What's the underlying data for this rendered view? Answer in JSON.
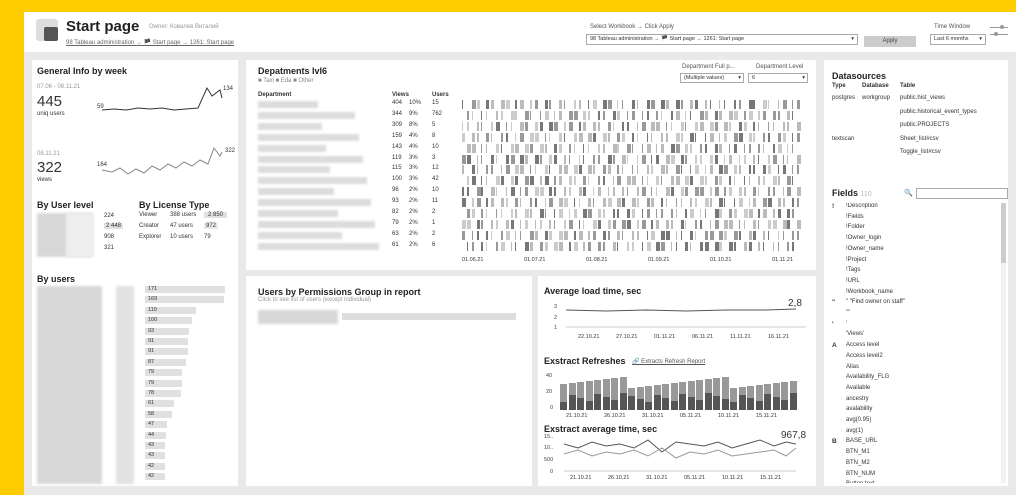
{
  "header": {
    "title": "Start page",
    "owner": "Owner: Ковалев Виталий",
    "breadcrumb": "98 Tableau administration → 🏴 Start page → 1261: Start page",
    "workbook_label": "Select Workbook → Click Apply",
    "workbook_value": "98 Tableau administration → 🏴 Start page → 1261: Start page",
    "apply": "Apply",
    "time_label": "Time Window",
    "time_value": "Last 6 months"
  },
  "general": {
    "title": "General Info by week",
    "date1": "07.06 - 08.11.21",
    "users": "445",
    "users_label": "uniq users",
    "u_min": "59",
    "u_max": "134",
    "date2": "08.11.21",
    "views": "322",
    "views_label": "views",
    "v_min": "164",
    "v_max": "322"
  },
  "user_level": {
    "title": "By User level",
    "values": [
      "224",
      "2 448",
      "908",
      "321"
    ]
  },
  "license": {
    "title": "By License Type",
    "rows": [
      [
        "Viewer",
        "388 users",
        "2 850"
      ],
      [
        "Creator",
        "47 users",
        "972"
      ],
      [
        "Explorer",
        "10 users",
        "79"
      ]
    ]
  },
  "by_users": {
    "title": "By users",
    "values": [
      "171",
      "169",
      "110",
      "100",
      "93",
      "91",
      "91",
      "87",
      "79",
      "79",
      "78",
      "61",
      "58",
      "47",
      "44",
      "43",
      "43",
      "42",
      "42"
    ]
  },
  "departments": {
    "title": "Depatments lvl6",
    "legend": [
      "Taxi",
      "Eda",
      "Other"
    ],
    "filter1_label": "Department Full p...",
    "filter1_value": "(Multiple values)",
    "filter2_label": "Department Level",
    "filter2_value": "6",
    "col_dept": "Department",
    "col_views": "Views",
    "col_users": "Users",
    "rows": [
      [
        "404",
        "10%",
        "15"
      ],
      [
        "344",
        "9%",
        "762"
      ],
      [
        "309",
        "8%",
        "5"
      ],
      [
        "159",
        "4%",
        "8"
      ],
      [
        "143",
        "4%",
        "10"
      ],
      [
        "119",
        "3%",
        "3"
      ],
      [
        "115",
        "3%",
        "12"
      ],
      [
        "100",
        "3%",
        "42"
      ],
      [
        "96",
        "2%",
        "10"
      ],
      [
        "93",
        "2%",
        "11"
      ],
      [
        "82",
        "2%",
        "2"
      ],
      [
        "79",
        "2%",
        "1"
      ],
      [
        "63",
        "2%",
        "2"
      ],
      [
        "61",
        "2%",
        "6"
      ]
    ],
    "dates": [
      "01.06.21",
      "01.07.21",
      "01.08.21",
      "01.09.21",
      "01.10.21",
      "01.11.21"
    ]
  },
  "permissions": {
    "title": "Users by Permissions Group in report",
    "subtitle": "Click to see list of users (except individual)"
  },
  "load": {
    "title": "Average load time, sec",
    "value": "2,8",
    "yticks": [
      "3",
      "2",
      "1"
    ],
    "dates": [
      "22.10.21",
      "27.10.21",
      "01.11.21",
      "06.11.21",
      "11.11.21",
      "16.11.21"
    ]
  },
  "refresh": {
    "title": "Exstract Refreshes",
    "link": "Extracts Refresh Report",
    "yticks": [
      "40",
      "20",
      "0"
    ],
    "dates": [
      "21.10.21",
      "26.10.21",
      "31.10.21",
      "05.11.21",
      "10.11.21",
      "15.11.21"
    ]
  },
  "extime": {
    "title": "Exstract average time, sec",
    "value": "967,8",
    "yticks": [
      "15..",
      "10..",
      "500",
      "0"
    ],
    "dates": [
      "21.10.21",
      "26.10.21",
      "31.10.21",
      "05.11.21",
      "10.11.21",
      "15.11.21"
    ]
  },
  "datasources": {
    "title": "Datasources",
    "cols": [
      "Type",
      "Database",
      "Table"
    ],
    "rows": [
      [
        "postgres",
        "workgroup",
        "public.hist_views"
      ],
      [
        "",
        "",
        "public.historical_event_types"
      ],
      [
        "",
        "",
        "public.PROJECTS"
      ],
      [
        "textscan",
        "",
        "Sheet_list#csv"
      ],
      [
        "",
        "",
        "Toggle_list#csv"
      ]
    ]
  },
  "fields": {
    "title": "Fields",
    "count": "110",
    "items": [
      [
        "!",
        "!Description"
      ],
      [
        "",
        "!Fields"
      ],
      [
        "",
        "!Folder"
      ],
      [
        "",
        "!Owner_login"
      ],
      [
        "",
        "!Owner_name"
      ],
      [
        "",
        "!Project"
      ],
      [
        "",
        "!Tags"
      ],
      [
        "",
        "!URL"
      ],
      [
        "",
        "!Workbook_name"
      ],
      [
        "\"",
        "\" \"Find owner on staff\""
      ],
      [
        "",
        "\"\""
      ],
      [
        "'",
        "'"
      ],
      [
        "",
        "'Views'"
      ],
      [
        "A",
        "Access level"
      ],
      [
        "",
        "Access level2"
      ],
      [
        "",
        "Alias"
      ],
      [
        "",
        "Availability_FLG"
      ],
      [
        "",
        "Available"
      ],
      [
        "",
        "ancestry"
      ],
      [
        "",
        "avalability"
      ],
      [
        "",
        "avg(0.95)"
      ],
      [
        "",
        "avg(1)"
      ],
      [
        "B",
        "BASE_URL"
      ],
      [
        "",
        "BTN_M1"
      ],
      [
        "",
        "BTN_M2"
      ],
      [
        "",
        "BTN_NUM"
      ],
      [
        "",
        "Button text"
      ]
    ]
  },
  "colors": {
    "accent": "#ffcc00",
    "bar": "#e0e0e0",
    "dark": "#666666"
  }
}
